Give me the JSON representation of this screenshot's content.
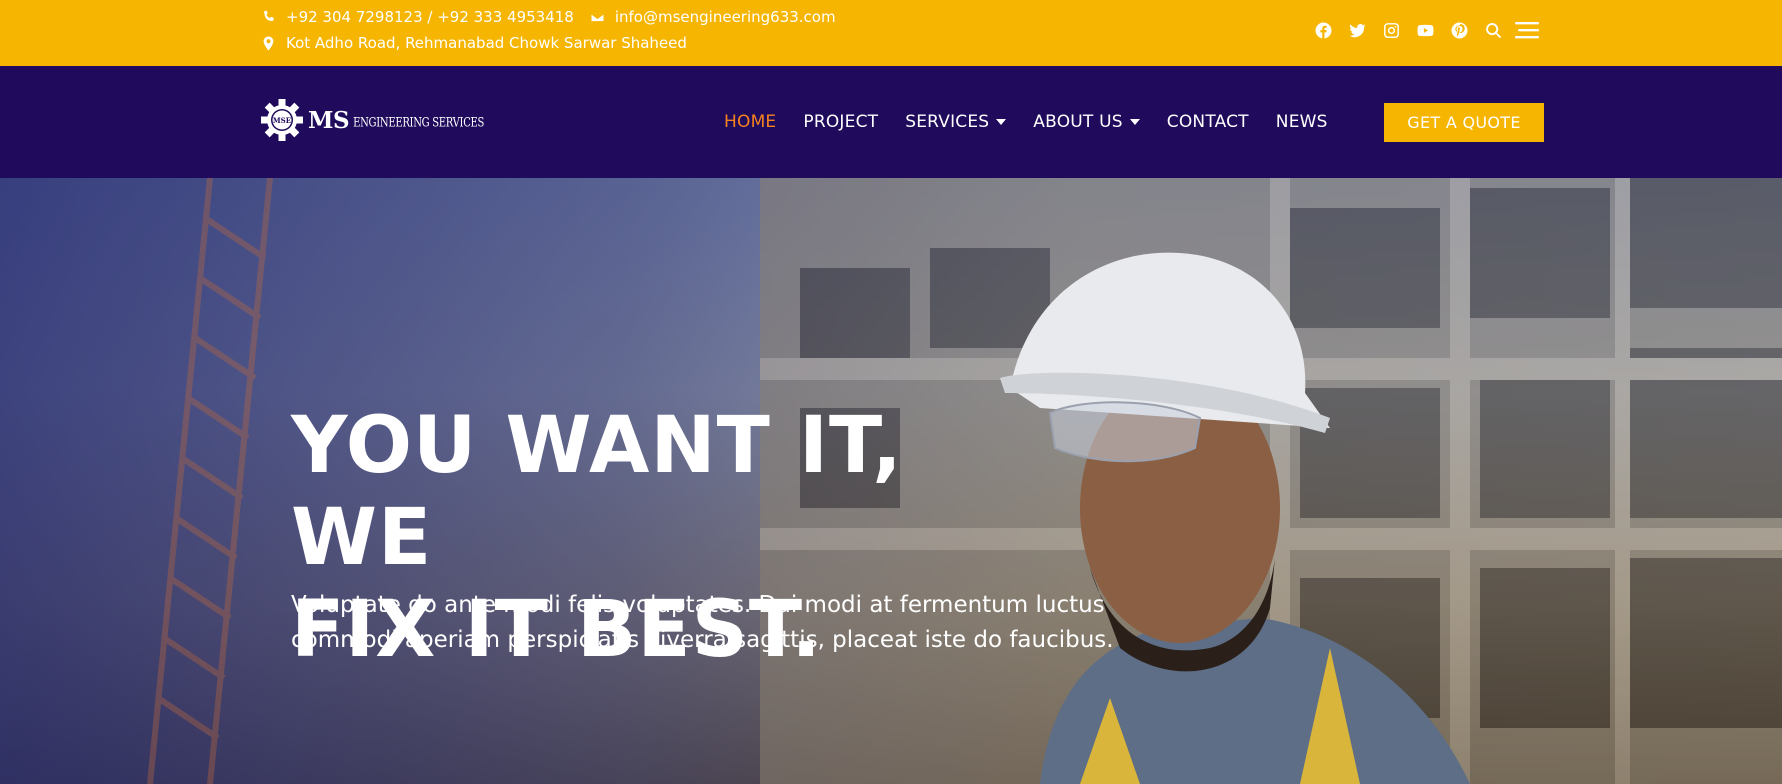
{
  "topbar": {
    "phone": "+92 304 7298123 / +92 333 4953418",
    "email": "info@msengineering633.com",
    "address": "Kot Adho Road, Rehmanabad Chowk Sarwar Shaheed",
    "icons": [
      "phone-icon",
      "envelope-icon",
      "map-marker-icon"
    ],
    "social": [
      "facebook-icon",
      "twitter-icon",
      "instagram-icon",
      "youtube-icon",
      "pinterest-icon",
      "search-icon",
      "hamburger-menu-icon"
    ],
    "bg_color": "#f6b500"
  },
  "header": {
    "logo_badge": "MSE",
    "logo_ms": "MS",
    "logo_sub": "ENGINEERING SERVICES",
    "bg_color": "#1f0a5c",
    "nav": [
      {
        "label": "HOME",
        "active": true
      },
      {
        "label": "PROJECT"
      },
      {
        "label": "SERVICES",
        "dropdown": true
      },
      {
        "label": "ABOUT US",
        "dropdown": true
      },
      {
        "label": "CONTACT"
      },
      {
        "label": "NEWS"
      }
    ],
    "cta_label": "GET A QUOTE",
    "active_color": "#f6821f"
  },
  "hero": {
    "title_line1": "YOU WANT IT, WE",
    "title_line2": "FIX IT BEST.",
    "text_line1": "Voluptate do ante modi felis voluptates. Dui modi at fermentum luctus",
    "text_line2": "commodi aperiam perspiciatis viverra sagittis, placeat iste do faucibus."
  }
}
